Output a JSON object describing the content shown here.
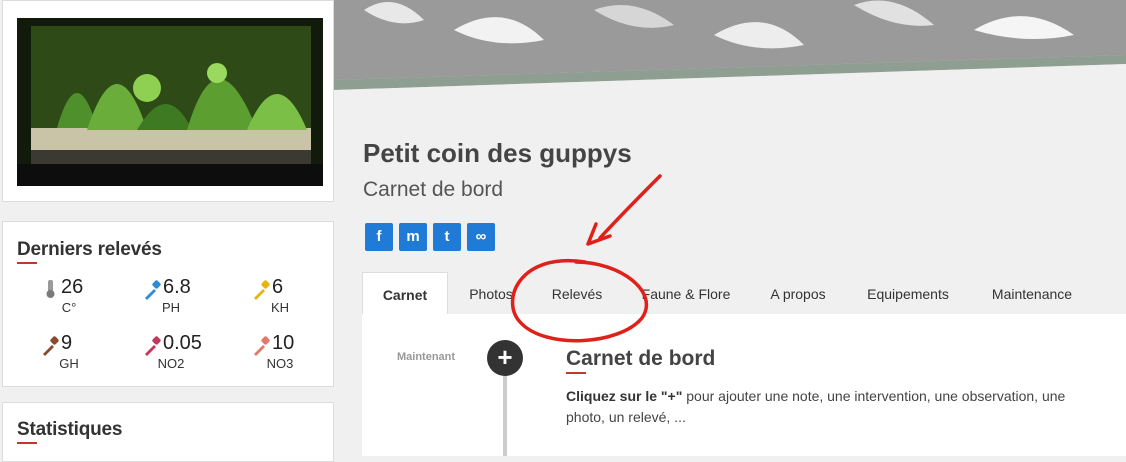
{
  "sidebar": {
    "releves": {
      "title": "Derniers relevés",
      "metrics": [
        {
          "value": "26",
          "label": "C°",
          "color": "#7a7a7a",
          "icon": "thermometer-icon"
        },
        {
          "value": "6.8",
          "label": "PH",
          "color": "#2e8bd4",
          "icon": "pipette-icon"
        },
        {
          "value": "6",
          "label": "KH",
          "color": "#e8b40f",
          "icon": "pipette-icon"
        },
        {
          "value": "9",
          "label": "GH",
          "color": "#8b4a2b",
          "icon": "pipette-icon"
        },
        {
          "value": "0.05",
          "label": "NO2",
          "color": "#c0395a",
          "icon": "pipette-icon"
        },
        {
          "value": "10",
          "label": "NO3",
          "color": "#e07a6a",
          "icon": "pipette-icon"
        }
      ]
    },
    "stats": {
      "title": "Statistiques"
    }
  },
  "header": {
    "title": "Petit coin des guppys",
    "subtitle": "Carnet de bord"
  },
  "share": {
    "facebook": "f",
    "messenger": "m",
    "twitter": "t",
    "link": "∞"
  },
  "tabs": [
    {
      "label": "Carnet",
      "active": true
    },
    {
      "label": "Photos"
    },
    {
      "label": "Relevés"
    },
    {
      "label": "Faune & Flore"
    },
    {
      "label": "A propos"
    },
    {
      "label": "Equipements"
    },
    {
      "label": "Maintenance"
    }
  ],
  "timeline": {
    "now_label": "Maintenant",
    "plus": "+",
    "entry_title": "Carnet de bord",
    "entry_bold": "Cliquez sur le \"+\"",
    "entry_text": " pour ajouter une note, une intervention, une observation, une photo, un relevé, ..."
  },
  "colors": {
    "accent": "#c0392b",
    "share": "#1f7bd6",
    "annotation": "#e0201a"
  }
}
